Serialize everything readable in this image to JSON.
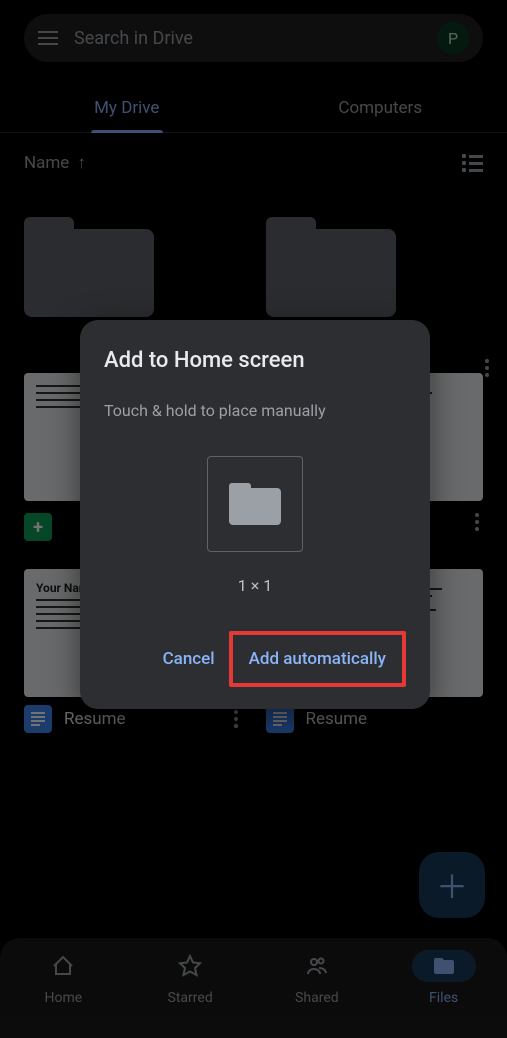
{
  "search": {
    "placeholder": "Search in Drive",
    "avatar_letter": "P"
  },
  "tabs": {
    "my_drive": "My Drive",
    "computers": "Computers"
  },
  "list_header": {
    "sort_label": "Name"
  },
  "files": {
    "resume_label": "Resume",
    "doc_preview_title": "Your Name"
  },
  "dialog": {
    "title": "Add to Home screen",
    "subtitle": "Touch & hold to place manually",
    "widget_size": "1 × 1",
    "cancel": "Cancel",
    "add": "Add automatically"
  },
  "bottom_nav": {
    "home": "Home",
    "starred": "Starred",
    "shared": "Shared",
    "files": "Files"
  }
}
